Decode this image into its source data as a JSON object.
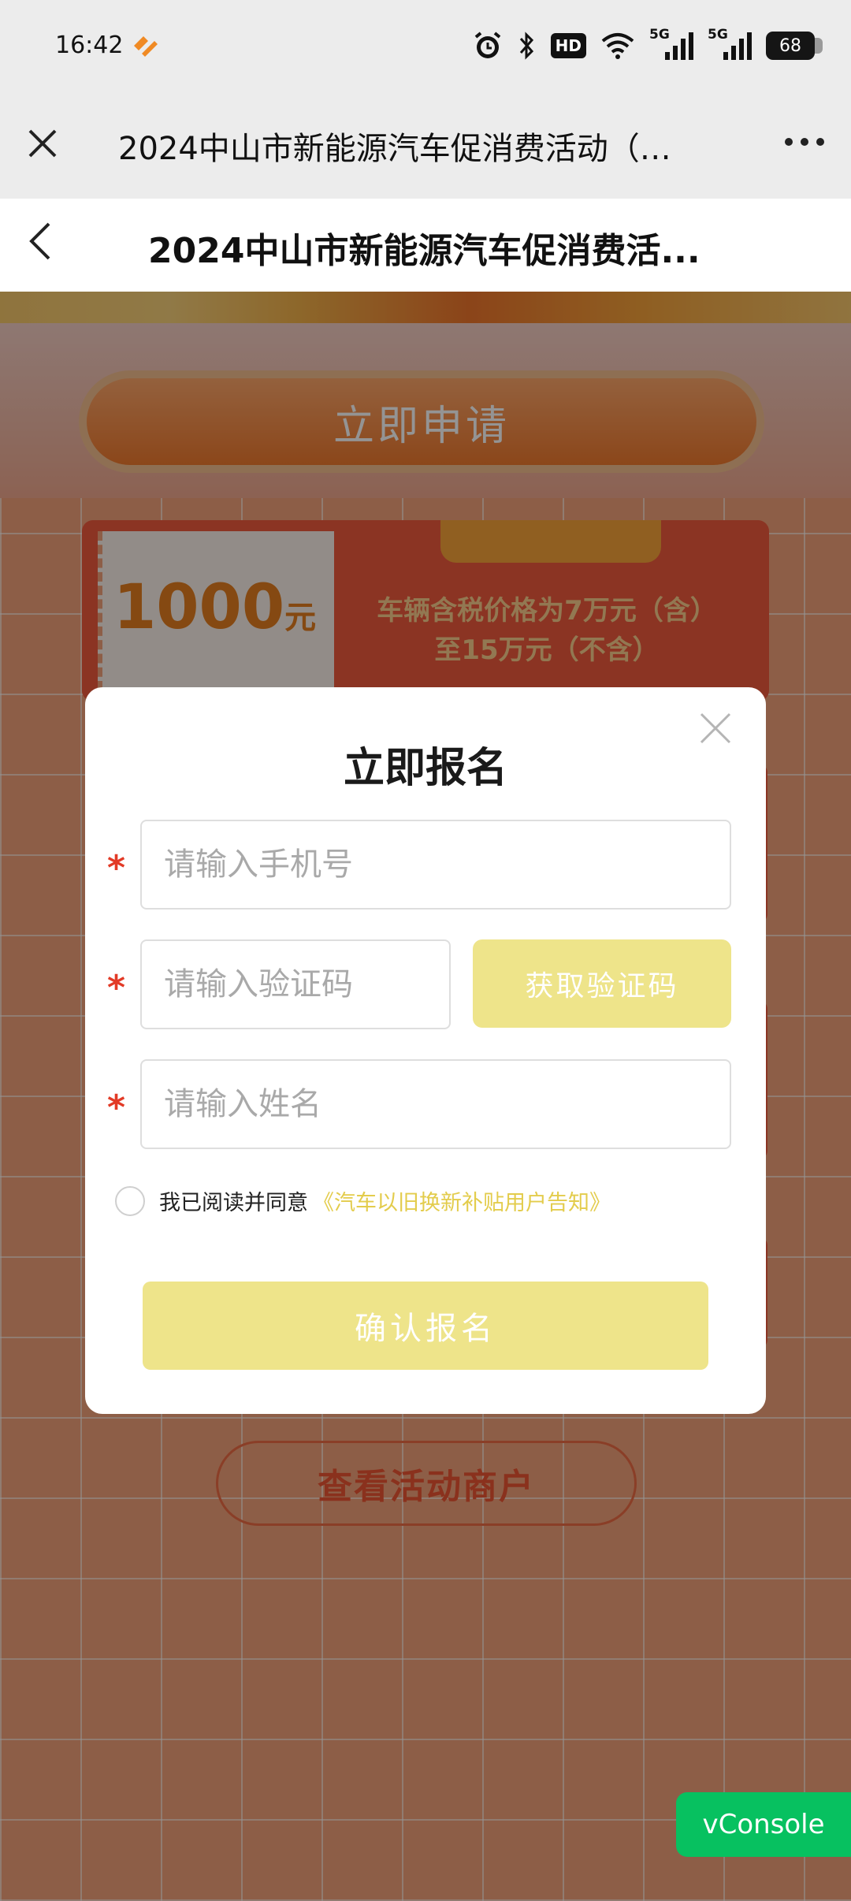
{
  "status_bar": {
    "time": "16:42",
    "app_icon": "orange-heart-app-icon",
    "icons": [
      "alarm-icon",
      "bluetooth-icon",
      "hd-icon",
      "wifi-icon",
      "5g-signal-icon",
      "5g-signal-icon"
    ],
    "hd_label": "HD",
    "network_1": "5G",
    "network_2": "5G",
    "battery": "68"
  },
  "webview_bar": {
    "title": "2024中山市新能源汽车促消费活动（…",
    "close_icon": "close-icon",
    "more_icon": "more-dots-icon"
  },
  "page_header": {
    "title": "2024中山市新能源汽车促消费活...",
    "back_icon": "back-chevron-icon"
  },
  "background": {
    "apply_button": "立即申请",
    "coupon": {
      "amount": "1000",
      "unit": "元",
      "description_line1": "车辆含税价格为7万元（含）",
      "description_line2": "至15万元（不含）"
    },
    "merchants_button": "查看活动商户"
  },
  "modal": {
    "title": "立即报名",
    "required_mark": "*",
    "phone_placeholder": "请输入手机号",
    "code_placeholder": "请输入验证码",
    "get_code_button": "获取验证码",
    "name_placeholder": "请输入姓名",
    "agree_text": "我已阅读并同意",
    "agree_link": "《汽车以旧换新补贴用户告知》",
    "confirm_button": "确认报名"
  },
  "vconsole": {
    "label": "vConsole"
  },
  "colors": {
    "accent_yellow": "#eee48a",
    "required_red": "#e23a26",
    "vconsole_green": "#07c160",
    "link_yellow": "#e3cc4c"
  }
}
